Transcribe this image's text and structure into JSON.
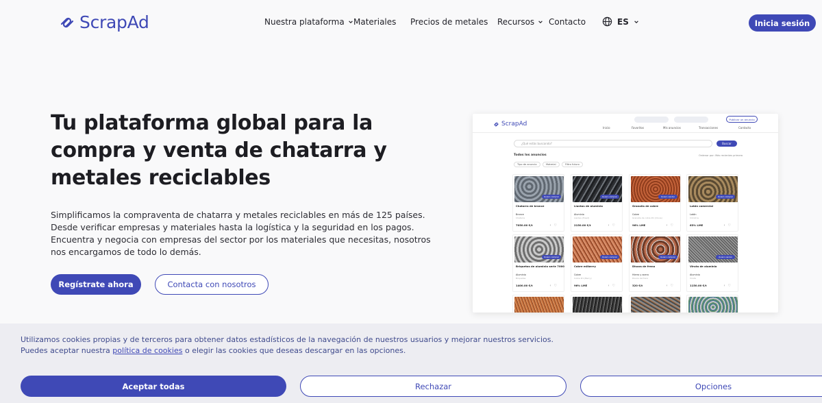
{
  "brand": {
    "name": "ScrapAd",
    "accent": "#3f49b6"
  },
  "nav": {
    "items": [
      {
        "label": "Nuestra plataforma",
        "has_dropdown": true
      },
      {
        "label": "Materiales",
        "has_dropdown": false
      },
      {
        "label": "Precios de metales",
        "has_dropdown": false
      },
      {
        "label": "Recursos",
        "has_dropdown": true
      },
      {
        "label": "Contacto",
        "has_dropdown": false
      }
    ],
    "language": "ES",
    "language_icon": "globe-icon",
    "login_label": "Inicia sesión"
  },
  "hero": {
    "title": "Tu plataforma global para la compra y venta de chatarra y metales reciclables",
    "text": "Simplificamos la compraventa de chatarra y metales reciclables en más de 125 países. Desde verificar empresas y materiales hasta la logística y la seguridad en los pagos. Encuentra y negocia con empresas del sector por los materiales que necesitas, nosotros nos encargamos de todo lo demás.",
    "primary_cta": "Regístrate ahora",
    "secondary_cta": "Contacta con nosotros"
  },
  "mockup": {
    "logo": "ScrapAd",
    "publish": "Publicar un anuncio",
    "tabs": [
      "Inicio",
      "Favoritos",
      "Mis anuncios",
      "Transacciones",
      "Contacto"
    ],
    "search_placeholder": "¿Qué estás buscando?",
    "search_button": "Buscar",
    "heading": "Todos los anuncios",
    "sort": "Ordenar por: Más recientes primero",
    "filters": [
      "Tipo de anuncio",
      "Material",
      "Filtro futuro"
    ],
    "quick_buy": "Quiero comprar",
    "quick_sell": "Quiero vender",
    "cards": [
      {
        "title": "Chatarra de bronce",
        "material": "Bronce",
        "sub": "Chatarra",
        "price": "7050.00 €/t",
        "texture": "t-brass",
        "cta": "buy"
      },
      {
        "title": "Llantas de aluminio",
        "material": "Aluminio",
        "sub": "Llantas (Tread)",
        "price": "2150.00 €/t",
        "texture": "t-alu1",
        "cta": "buy"
      },
      {
        "title": "Granalla de cobre",
        "material": "Cobre",
        "sub": "Granalla de cobre #1 (Clove)",
        "price": "96% LME",
        "texture": "t-copper1",
        "cta": "sell"
      },
      {
        "title": "Latón comercial",
        "material": "Latón",
        "sub": "Cilindros",
        "price": "63% LME",
        "texture": "t-brass2",
        "cta": "buy"
      },
      {
        "title": "Briquetas de aluminio serie 7000",
        "material": "Aluminio",
        "sub": "Briquetas",
        "price": "1400.00 €/t",
        "texture": "t-alu2",
        "cta": "buy"
      },
      {
        "title": "Cobre milberry",
        "material": "Cobre",
        "sub": "Cobre #1 (Berry)",
        "price": "96% LME",
        "texture": "t-copper2",
        "cta": "buy"
      },
      {
        "title": "Discos de freno",
        "material": "Hierro y acero",
        "sub": "Discos de freno",
        "price": "320 €/t",
        "texture": "t-brake",
        "cta": "buy"
      },
      {
        "title": "Viruta de aluminio",
        "material": "Aluminio",
        "sub": "Viruta",
        "price": "1150.00 €/t",
        "texture": "t-alu3",
        "cta": "sell"
      },
      {
        "title": "",
        "material": "",
        "sub": "",
        "price": "",
        "texture": "t-wire",
        "cta": ""
      },
      {
        "title": "",
        "material": "",
        "sub": "",
        "price": "",
        "texture": "t-mix",
        "cta": ""
      },
      {
        "title": "",
        "material": "",
        "sub": "",
        "price": "",
        "texture": "t-cable",
        "cta": ""
      },
      {
        "title": "",
        "material": "",
        "sub": "",
        "price": "",
        "texture": "t-cans",
        "cta": ""
      }
    ]
  },
  "cookies": {
    "line1": "Utilizamos cookies propias y de terceros para obtener datos estadísticos de la navegación de nuestros usuarios y mejorar nuestros servicios.",
    "line2_before": "Puedes aceptar nuestra ",
    "policy_link": "política de cookies",
    "line2_after": " o elegir las cookies que deseas descargar en las opciones.",
    "accept": "Aceptar todas",
    "reject": "Rechazar",
    "options": "Opciones"
  }
}
